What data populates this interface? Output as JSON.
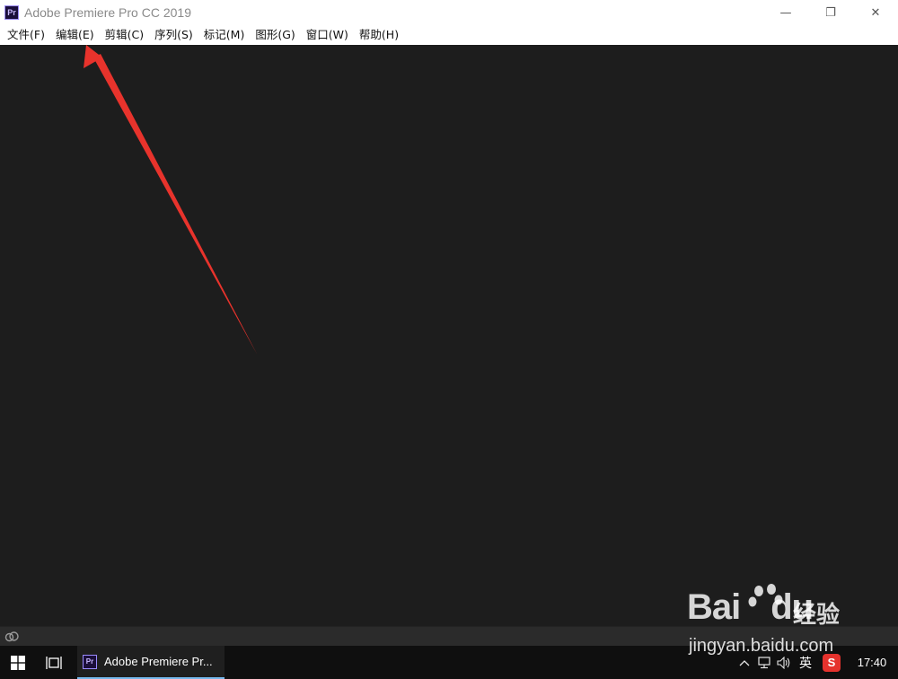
{
  "window": {
    "app_icon_text": "Pr",
    "title": "Adobe Premiere Pro CC 2019",
    "controls": {
      "minimize": "—",
      "restore": "❐",
      "close": "✕"
    }
  },
  "menubar": {
    "items": [
      {
        "label": "文件(F)"
      },
      {
        "label": "编辑(E)"
      },
      {
        "label": "剪辑(C)"
      },
      {
        "label": "序列(S)"
      },
      {
        "label": "标记(M)"
      },
      {
        "label": "图形(G)"
      },
      {
        "label": "窗口(W)"
      },
      {
        "label": "帮助(H)"
      }
    ]
  },
  "statusbar": {
    "icon": "creative-cloud-icon"
  },
  "taskbar": {
    "active_app": {
      "icon_text": "Pr",
      "label": "Adobe Premiere Pr..."
    },
    "tray": {
      "ime": "英",
      "sogou": "S",
      "clock": "17:40"
    }
  },
  "annotation": {
    "type": "arrow",
    "color": "#e8332c",
    "points_to": "编辑(E)"
  },
  "watermark": {
    "brand": "Bai",
    "brand_suffix": "du",
    "cn": "经验",
    "url": "jingyan.baidu.com"
  },
  "colors": {
    "workspace_bg": "#1d1d1d",
    "titlebar_bg": "#ffffff",
    "taskbar_bg": "#0f0f0f",
    "taskbar_accent": "#76b9ed",
    "arrow": "#e8332c"
  }
}
